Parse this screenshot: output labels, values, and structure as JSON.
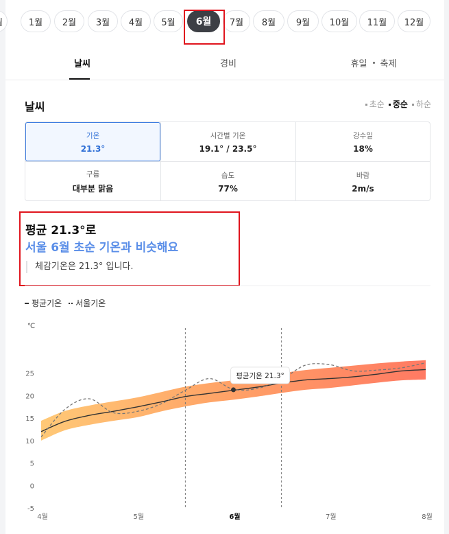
{
  "months": [
    {
      "label": "월",
      "active": false
    },
    {
      "label": "1월",
      "active": false
    },
    {
      "label": "2월",
      "active": false
    },
    {
      "label": "3월",
      "active": false
    },
    {
      "label": "4월",
      "active": false
    },
    {
      "label": "5월",
      "active": false
    },
    {
      "label": "6월",
      "active": true
    },
    {
      "label": "7월",
      "active": false
    },
    {
      "label": "8월",
      "active": false
    },
    {
      "label": "9월",
      "active": false
    },
    {
      "label": "10월",
      "active": false
    },
    {
      "label": "11월",
      "active": false
    },
    {
      "label": "12월",
      "active": false
    }
  ],
  "tabs": {
    "weather": "날씨",
    "cost": "경비",
    "holiday": "휴일",
    "festival": "축제"
  },
  "section": {
    "title": "날씨",
    "periods": [
      {
        "label": "초순",
        "on": false
      },
      {
        "label": "중순",
        "on": true
      },
      {
        "label": "하순",
        "on": false
      }
    ]
  },
  "stats": {
    "temp": {
      "label": "기온",
      "value": "21.3°"
    },
    "hourly": {
      "label": "시간별 기온",
      "value": "19.1° / 23.5°"
    },
    "rain": {
      "label": "강수일",
      "value": "18%"
    },
    "cloud": {
      "label": "구름",
      "value": "대부분 맑음"
    },
    "humidity": {
      "label": "습도",
      "value": "77%"
    },
    "wind": {
      "label": "바람",
      "value": "2m/s"
    }
  },
  "summary": {
    "line1": "평균 21.3°로",
    "line2": "서울 6월 초순 기온과 비슷해요",
    "note": "체감기온은 21.3° 입니다."
  },
  "legend": {
    "avg": "평균기온",
    "seoul": "서울기온"
  },
  "chart_data": {
    "type": "line",
    "unit": "℃",
    "ylim": [
      -5,
      30
    ],
    "yticks": [
      25,
      20,
      15,
      10,
      5,
      0,
      -5
    ],
    "xlim": [
      4,
      8
    ],
    "xticks": [
      {
        "x": 4,
        "label": "4월",
        "bold": false
      },
      {
        "x": 5,
        "label": "5월",
        "bold": false
      },
      {
        "x": 6,
        "label": "6월",
        "bold": true
      },
      {
        "x": 7,
        "label": "7월",
        "bold": false
      },
      {
        "x": 8,
        "label": "8월",
        "bold": false
      }
    ],
    "highlight_range": [
      5.5,
      6.5
    ],
    "tooltip": {
      "x": 6,
      "y": 21.3,
      "label": "평균기온 21.3°"
    },
    "series": [
      {
        "name": "평균기온",
        "style": "solid",
        "x": [
          4,
          4.25,
          4.5,
          4.75,
          5,
          5.25,
          5.5,
          5.75,
          6,
          6.25,
          6.5,
          6.75,
          7,
          7.25,
          7.5,
          7.75,
          8
        ],
        "y": [
          12.0,
          14.3,
          15.6,
          16.5,
          17.5,
          18.6,
          19.8,
          20.5,
          21.2,
          21.9,
          22.8,
          23.5,
          23.8,
          24.2,
          24.8,
          25.5,
          25.8
        ]
      },
      {
        "name": "서울기온",
        "style": "dashed",
        "x": [
          4,
          4.25,
          4.5,
          4.75,
          5,
          5.25,
          5.5,
          5.75,
          6,
          6.25,
          6.5,
          6.75,
          7,
          7.25,
          7.5,
          7.75,
          8
        ],
        "y": [
          10.8,
          17.0,
          19.3,
          16.2,
          16.5,
          18.2,
          21.2,
          23.8,
          21.4,
          21.6,
          23.6,
          26.8,
          26.9,
          25.5,
          25.7,
          26.2,
          27.3
        ]
      }
    ],
    "band": {
      "x": [
        4,
        4.25,
        4.5,
        4.75,
        5,
        5.25,
        5.5,
        5.75,
        6,
        6.25,
        6.5,
        6.75,
        7,
        7.25,
        7.5,
        7.75,
        8
      ],
      "low": [
        10.0,
        12.3,
        13.5,
        14.4,
        15.2,
        16.5,
        17.6,
        18.5,
        19.1,
        19.8,
        20.6,
        21.3,
        21.7,
        22.3,
        22.9,
        23.4,
        23.6
      ],
      "high": [
        14.4,
        16.6,
        17.8,
        18.7,
        19.6,
        20.8,
        22.0,
        22.8,
        23.4,
        24.1,
        25.0,
        25.7,
        26.2,
        26.7,
        27.2,
        27.6,
        27.9
      ]
    }
  }
}
